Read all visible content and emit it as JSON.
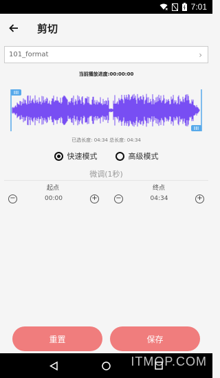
{
  "status_bar": {
    "time": "7:01",
    "icons": [
      "wifi-icon",
      "no-sim-icon",
      "battery-icon"
    ]
  },
  "app_bar": {
    "title": "剪切",
    "back_icon": "arrow-left-icon"
  },
  "file": {
    "name": "101_format",
    "chevron_icon": "chevron-right-icon"
  },
  "playback": {
    "text": "当前播放进度:00:00:00"
  },
  "waveform": {
    "left_handle_icon": "handle-icon",
    "right_handle_icon": "handle-icon",
    "color": "#6a3bf3",
    "handle_color": "#57a9ea"
  },
  "selection": {
    "text": "已选长度: 04:34 总长度: 04:34"
  },
  "modes": [
    {
      "label": "快速模式",
      "selected": true
    },
    {
      "label": "高级模式",
      "selected": false
    }
  ],
  "fine_tune": {
    "title": "微调(1秒)"
  },
  "start": {
    "label": "起点",
    "value": "00:00"
  },
  "end": {
    "label": "终点",
    "value": "04:34"
  },
  "buttons": {
    "reset": "重置",
    "save": "保存",
    "color": "#f07d7d"
  },
  "nav_bar": {
    "back_icon": "nav-back-icon",
    "home_icon": "nav-home-icon",
    "recents_icon": "nav-recents-icon"
  },
  "watermark": "ITMOP.COM"
}
